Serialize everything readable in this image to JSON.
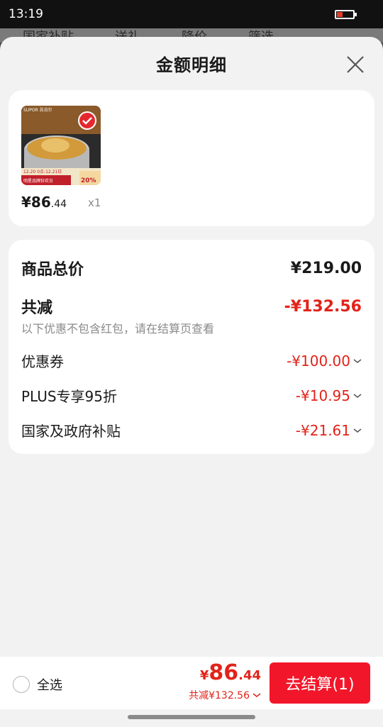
{
  "status_bar": {
    "time": "13:19"
  },
  "background_tabs": [
    "国家补贴",
    "送礼",
    "降价",
    "筛选"
  ],
  "sheet": {
    "title": "金额明细"
  },
  "product": {
    "price_main": "¥86",
    "price_cents": ".44",
    "quantity": "x1",
    "thumb_brand": "SUPOR 苏泊尔",
    "thumb_promo_date": "12.20 0点-12.21日",
    "thumb_promo_text": "明星品牌狂欢日",
    "thumb_discount": "20%"
  },
  "details": {
    "total_label": "商品总价",
    "total_value": "¥219.00",
    "discount_label": "共减",
    "discount_value": "-¥132.56",
    "hint": "以下优惠不包含红包，请在结算页查看",
    "items": [
      {
        "label": "优惠券",
        "value": "-¥100.00"
      },
      {
        "label": "PLUS专享95折",
        "value": "-¥10.95"
      },
      {
        "label": "国家及政府补贴",
        "value": "-¥21.61"
      }
    ]
  },
  "bottom_bar": {
    "select_all_label": "全选",
    "total_yen": "¥",
    "total_main": "86",
    "total_cents": ".44",
    "saved_text": "共减¥132.56",
    "checkout_label": "去结算(1)"
  },
  "colors": {
    "accent_red": "#e2231a",
    "button_red": "#f2162a"
  }
}
